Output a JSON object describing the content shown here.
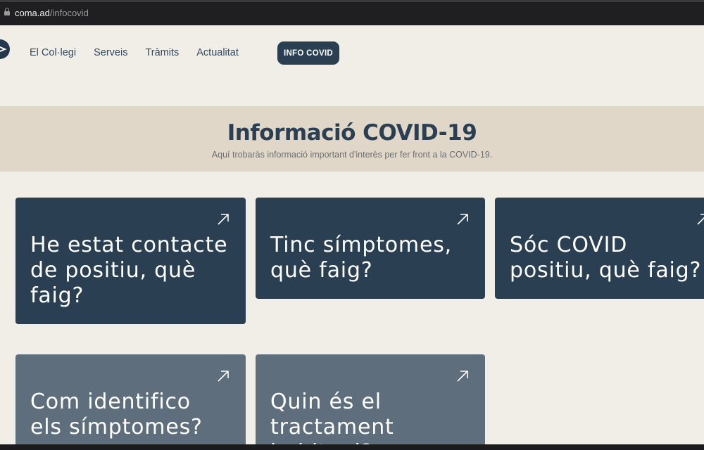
{
  "browser": {
    "url_host": "coma.ad",
    "url_path": "/infocovid"
  },
  "nav": {
    "items": [
      "El Col·legi",
      "Serveis",
      "Tràmits",
      "Actualitat"
    ],
    "cta_label": "INFO COVID"
  },
  "hero": {
    "title": "Informació COVID-19",
    "subtitle": "Aquí trobaràs informació important d'interès per fer front a la COVID-19."
  },
  "cards": [
    {
      "label": "He estat contacte\nde positiu, què\nfaig?",
      "icon": "arrow-up-right-icon"
    },
    {
      "label": "Tinc símptomes,\nquè faig?",
      "icon": "arrow-up-right-icon"
    },
    {
      "label": "Sóc COVID\npositiu, què faig?",
      "icon": "arrow-up-right-icon"
    },
    {
      "label": "Com identifico\nels símptomes?",
      "icon": "arrow-up-right-icon"
    },
    {
      "label": "Quin és el\ntractament\nhabitual?",
      "icon": "arrow-up-right-icon"
    }
  ],
  "colors": {
    "page_bg": "#f1eee8",
    "hero_bg": "#e1d7c9",
    "card_dark": "#2b3f52",
    "card_light": "#5e6e7c"
  }
}
